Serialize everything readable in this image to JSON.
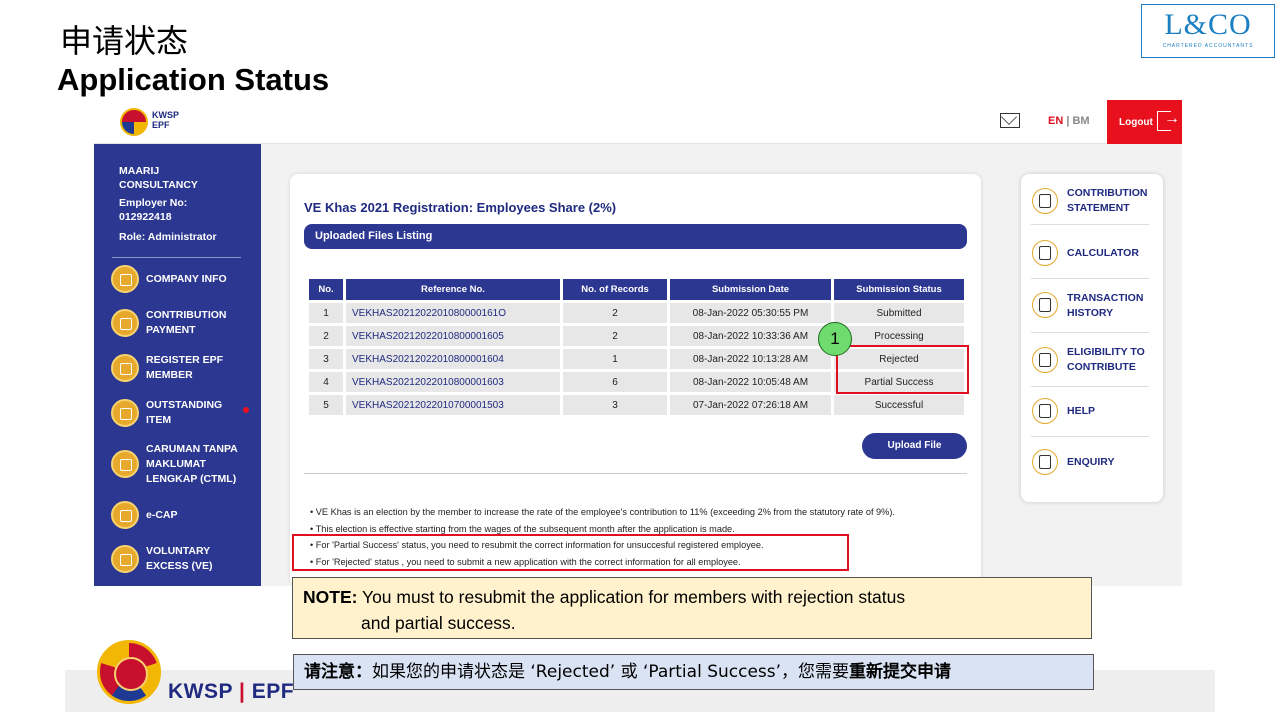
{
  "slide": {
    "title_cn": "申请状态",
    "title_en": "Application Status",
    "lco_logo": "L&CO",
    "lco_sub": "CHARTERED ACCOUNTANTS"
  },
  "topbar": {
    "logo_line1": "KWSP",
    "logo_line2": "EPF",
    "lang_en": "EN",
    "lang_sep": " | ",
    "lang_bm": "BM",
    "logout_label": "Logout"
  },
  "sidebar": {
    "company": [
      "MAARIJ",
      "CONSULTANCY"
    ],
    "employer_label": "Employer No:",
    "employer_no": "012922418",
    "role": "Role: Administrator",
    "items": [
      {
        "label": [
          "COMPANY INFO"
        ],
        "icon": "gear-icon"
      },
      {
        "label": [
          "CONTRIBUTION",
          "PAYMENT"
        ],
        "icon": "payment-icon"
      },
      {
        "label": [
          "REGISTER EPF",
          "MEMBER"
        ],
        "icon": "user-add-icon"
      },
      {
        "label": [
          "OUTSTANDING",
          "ITEM"
        ],
        "icon": "money-bag-icon"
      },
      {
        "label": [
          "CARUMAN TANPA",
          "MAKLUMAT",
          "LENGKAP (CTML)"
        ],
        "icon": "document-icon"
      },
      {
        "label": [
          "e-CAP"
        ],
        "icon": "shop-icon"
      },
      {
        "label": [
          "VOLUNTARY",
          "EXCESS (VE)"
        ],
        "icon": "file-icon"
      }
    ]
  },
  "main": {
    "title": "VE Khas 2021 Registration: Employees Share (2%)",
    "section": "Uploaded Files Listing",
    "columns": [
      "No.",
      "Reference No.",
      "No. of Records",
      "Submission Date",
      "Submission Status"
    ],
    "rows": [
      [
        "1",
        "VEKHAS2021202201080000161O",
        "2",
        "08-Jan-2022 05:30:55 PM",
        "Submitted"
      ],
      [
        "2",
        "VEKHAS20212022010800001605",
        "2",
        "08-Jan-2022 10:33:36 AM",
        "Processing"
      ],
      [
        "3",
        "VEKHAS20212022010800001604",
        "1",
        "08-Jan-2022 10:13:28 AM",
        "Rejected"
      ],
      [
        "4",
        "VEKHAS20212022010800001603",
        "6",
        "08-Jan-2022 10:05:48 AM",
        "Partial Success"
      ],
      [
        "5",
        "VEKHAS20212022010700001503",
        "3",
        "07-Jan-2022 07:26:18 AM",
        "Successful"
      ]
    ],
    "upload_button": "Upload File",
    "notes": [
      "VE Khas is an election by the member to increase the rate of the employee's contribution to 11% (exceeding 2% from the statutory rate of 9%).",
      "This election is effective starting from the wages of the subsequent month after the application is made.",
      "For 'Partial Success' status, you need to resubmit the correct information for unsuccesful registered employee.",
      "For 'Rejected' status , you need to submit a new application with the correct information for all employee."
    ]
  },
  "right_panel": [
    {
      "label": [
        "CONTRIBUTION",
        "STATEMENT"
      ],
      "icon": "statement-icon"
    },
    {
      "label": [
        "CALCULATOR"
      ],
      "icon": "calculator-icon"
    },
    {
      "label": [
        "TRANSACTION",
        "HISTORY"
      ],
      "icon": "history-icon"
    },
    {
      "label": [
        "ELIGIBILITY TO",
        "CONTRIBUTE"
      ],
      "icon": "eligibility-icon"
    },
    {
      "label": [
        "HELP"
      ],
      "icon": "help-icon"
    },
    {
      "label": [
        "ENQUIRY"
      ],
      "icon": "enquiry-icon"
    }
  ],
  "annotation": {
    "marker": "1",
    "note_label": "NOTE:",
    "note_line1": " You must to resubmit the application for members with rejection status",
    "note_line2": "and partial success.",
    "cn_label": "请注意：",
    "cn_text": "如果您的申请状态是 ‘Rejected’ 或 ‘Partial Success’，您需要",
    "cn_bold": "重新提交申请"
  },
  "footer": {
    "brand_kwsp": "KWSP",
    "brand_sep": "|",
    "brand_epf": "EPF"
  },
  "colors": {
    "navy": "#2b3791",
    "red": "#e8101c",
    "gold": "#e7a92c",
    "note_yellow": "#fff2cc",
    "note_blue": "#dae3f3",
    "marker_green": "#6fdb6f"
  }
}
